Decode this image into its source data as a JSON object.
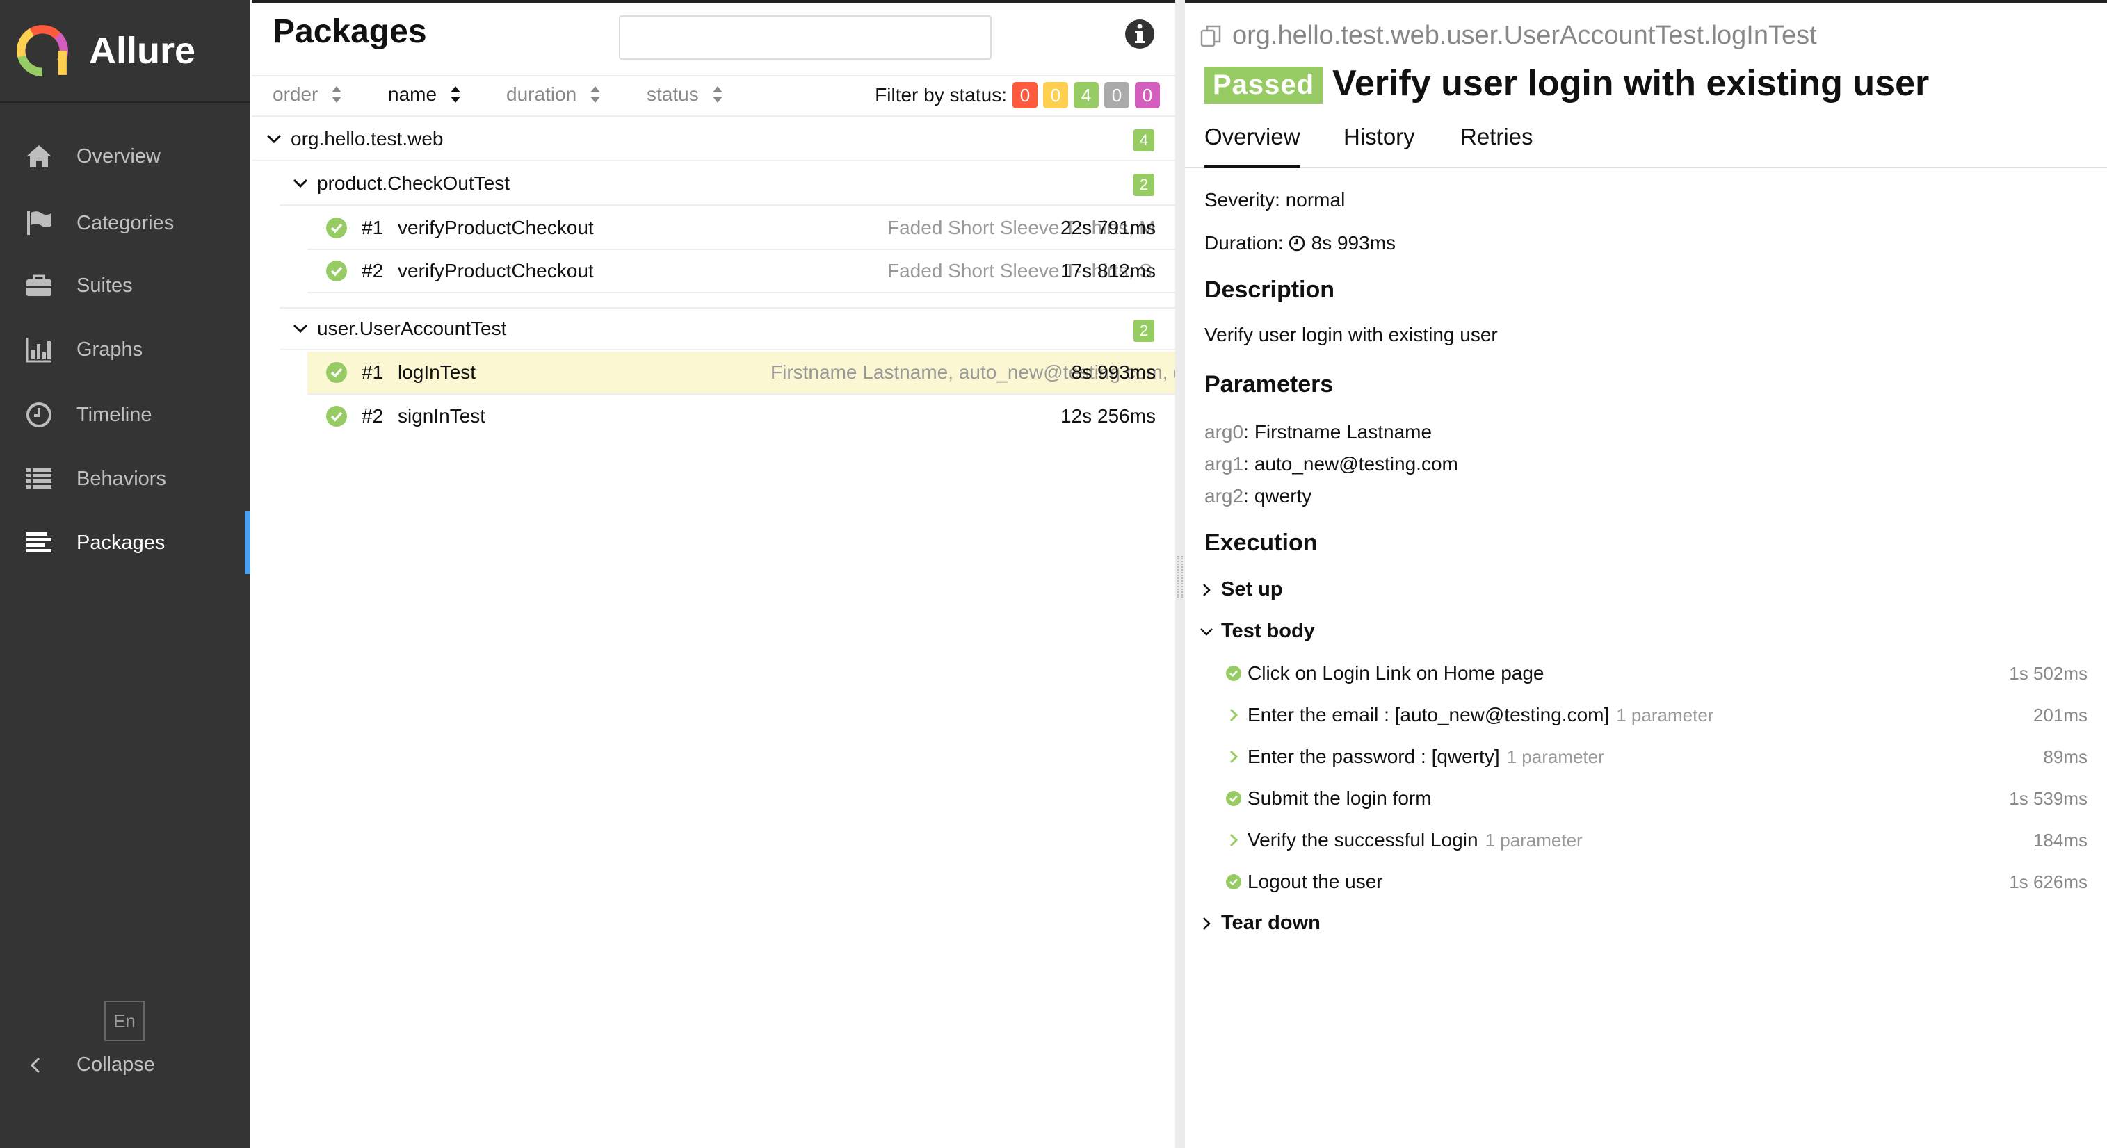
{
  "sidebar": {
    "brand": "Allure",
    "items": [
      {
        "label": "Overview",
        "icon": "home-icon"
      },
      {
        "label": "Categories",
        "icon": "flag-icon"
      },
      {
        "label": "Suites",
        "icon": "briefcase-icon"
      },
      {
        "label": "Graphs",
        "icon": "bar-chart-icon"
      },
      {
        "label": "Timeline",
        "icon": "clock-icon"
      },
      {
        "label": "Behaviors",
        "icon": "list-icon"
      },
      {
        "label": "Packages",
        "icon": "align-left-icon"
      }
    ],
    "active_item": "Packages",
    "language": "En",
    "collapse_label": "Collapse"
  },
  "tree": {
    "title": "Packages",
    "search_placeholder": "",
    "columns": {
      "order": "order",
      "name": "name",
      "duration": "duration",
      "status": "status"
    },
    "filter_label": "Filter by status:",
    "status_filters": [
      {
        "count": "0",
        "color": "#fd5a3e",
        "status": "failed"
      },
      {
        "count": "0",
        "color": "#ffd050",
        "status": "broken"
      },
      {
        "count": "4",
        "color": "#97cc64",
        "status": "passed"
      },
      {
        "count": "0",
        "color": "#aaaaaa",
        "status": "skipped"
      },
      {
        "count": "0",
        "color": "#d35ebe",
        "status": "unknown"
      }
    ],
    "package": {
      "name": "org.hello.test.web",
      "count": "4"
    },
    "groups": [
      {
        "name": "product.CheckOutTest",
        "count": "2",
        "cases": [
          {
            "num": "#1",
            "name": "verifyProductCheckout",
            "params": "Faded Short Sleeve T-shirts, M",
            "duration": "22s 791ms"
          },
          {
            "num": "#2",
            "name": "verifyProductCheckout",
            "params": "Faded Short Sleeve T-shirts, S",
            "duration": "17s 812ms"
          }
        ]
      },
      {
        "name": "user.UserAccountTest",
        "count": "2",
        "cases": [
          {
            "num": "#1",
            "name": "logInTest",
            "params": "Firstname Lastname, auto_new@testing.com, qwerty",
            "duration": "8s 993ms"
          },
          {
            "num": "#2",
            "name": "signInTest",
            "params": "",
            "duration": "12s 256ms"
          }
        ]
      }
    ]
  },
  "detail": {
    "path": "org.hello.test.web.user.UserAccountTest.logInTest",
    "status": "Passed",
    "title": "Verify user login with existing user",
    "tabs": [
      "Overview",
      "History",
      "Retries"
    ],
    "severity": "Severity: normal",
    "duration_label": "Duration:",
    "duration": "8s 993ms",
    "description_heading": "Description",
    "description": "Verify user login with existing user",
    "parameters_heading": "Parameters",
    "parameters": [
      {
        "key": "arg0",
        "value": "Firstname Lastname"
      },
      {
        "key": "arg1",
        "value": "auto_new@testing.com"
      },
      {
        "key": "arg2",
        "value": "qwerty"
      }
    ],
    "execution_heading": "Execution",
    "setup": "Set up",
    "test_body": "Test body",
    "teardown": "Tear down",
    "steps": [
      {
        "label": "Click on Login Link on Home page",
        "params": "",
        "duration": "1s 502ms",
        "kind": "passed"
      },
      {
        "label": "Enter the email : [auto_new@testing.com]",
        "params": "1 parameter",
        "duration": "201ms",
        "kind": "expand"
      },
      {
        "label": "Enter the password : [qwerty]",
        "params": "1 parameter",
        "duration": "89ms",
        "kind": "expand"
      },
      {
        "label": "Submit the login form",
        "params": "",
        "duration": "1s 539ms",
        "kind": "passed"
      },
      {
        "label": "Verify the successful Login",
        "params": "1 parameter",
        "duration": "184ms",
        "kind": "expand"
      },
      {
        "label": "Logout the user",
        "params": "",
        "duration": "1s 626ms",
        "kind": "passed"
      }
    ]
  },
  "colors": {
    "passed": "#97cc64",
    "sidebar": "#343434",
    "accent": "#4a9ff0",
    "selected_row": "#fcf7d3"
  }
}
